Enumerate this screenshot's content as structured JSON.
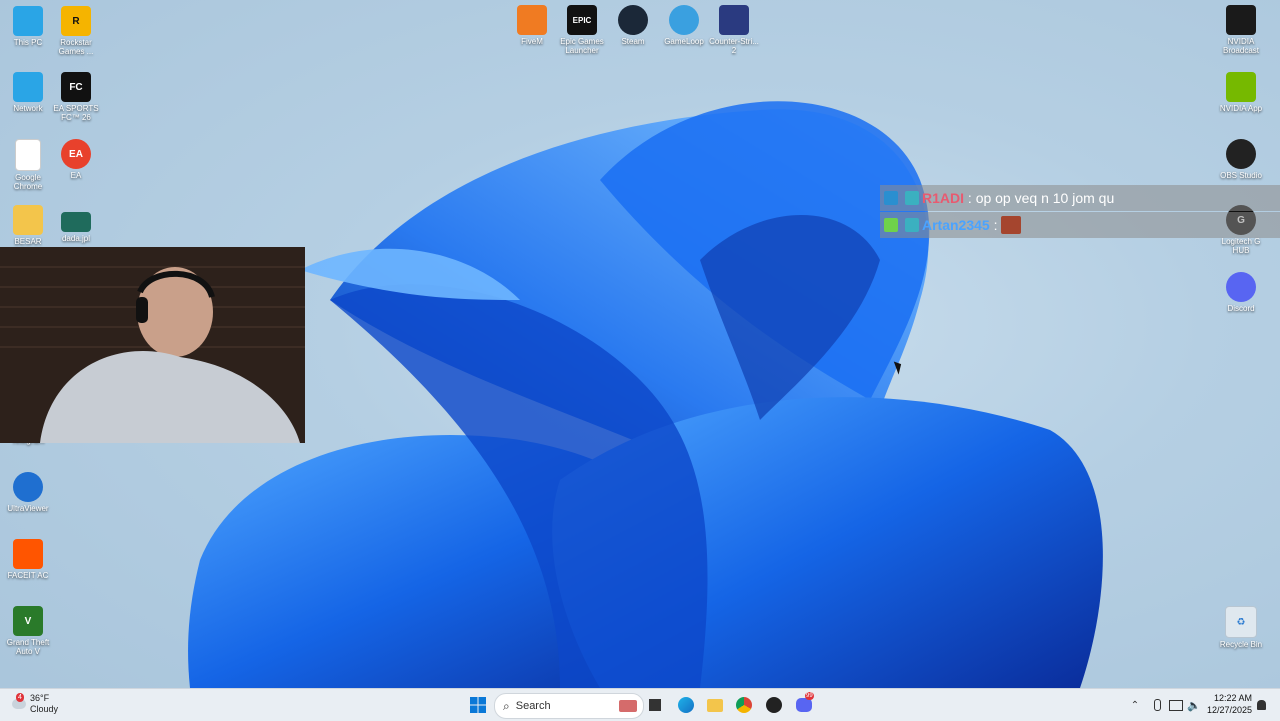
{
  "desktop_icons_left": [
    {
      "label": "This PC",
      "icon": "monitor-icon",
      "color": "#2aa5e6"
    },
    {
      "label": "Rockstar Games ...",
      "icon": "rockstar-icon",
      "color": "#f5b400"
    },
    {
      "label": "Network",
      "icon": "network-icon",
      "color": "#2aa5e6"
    },
    {
      "label": "EA SPORTS FC™ 26",
      "icon": "fc26-icon",
      "color": "#111111"
    },
    {
      "label": "Google Chrome",
      "icon": "file-icon",
      "color": "#ffffff"
    },
    {
      "label": "EA",
      "icon": "ea-icon",
      "color": "#e8412c"
    },
    {
      "label": "BESAR",
      "icon": "folder-icon",
      "color": "#f3c54b"
    },
    {
      "label": "dada.jpl",
      "icon": "image-icon",
      "color": "#1f6b5c"
    },
    {
      "label": "Telegram",
      "icon": "telegram-icon",
      "color": "#2aa5e6"
    },
    {
      "label": "UltraViewer",
      "icon": "ultraviewer-icon",
      "color": "#1f6fd0"
    },
    {
      "label": "FACEIT AC",
      "icon": "faceit-icon",
      "color": "#ff5500"
    },
    {
      "label": "Grand Theft Auto V",
      "icon": "gta-icon",
      "color": "#2a7a2a"
    }
  ],
  "desktop_icons_top": [
    {
      "label": "FiveM",
      "icon": "fivem-icon",
      "color": "#f07b22"
    },
    {
      "label": "Epic Games Launcher",
      "icon": "epic-icon",
      "color": "#111111"
    },
    {
      "label": "Steam",
      "icon": "steam-icon",
      "color": "#1b2838"
    },
    {
      "label": "GameLoop",
      "icon": "gameloop-icon",
      "color": "#3aa0e0"
    },
    {
      "label": "Counter-Stri... 2",
      "icon": "cs2-icon",
      "color": "#e6a020"
    }
  ],
  "desktop_icons_right": [
    {
      "label": "NVIDIA Broadcast",
      "icon": "nvidia-broadcast-icon",
      "color": "#1a1a1a"
    },
    {
      "label": "NVIDIA App",
      "icon": "nvidia-icon",
      "color": "#76b900"
    },
    {
      "label": "OBS Studio",
      "icon": "obs-icon",
      "color": "#222222"
    },
    {
      "label": "Logitech G HUB",
      "icon": "logitech-icon",
      "color": "#111111"
    },
    {
      "label": "Discord",
      "icon": "discord-icon",
      "color": "#5865f2"
    },
    {
      "label": "Recycle Bin",
      "icon": "recycle-bin-icon",
      "color": "#dfe8ef"
    }
  ],
  "chat": [
    {
      "user": "R1ADI",
      "user_color": "#e85a70",
      "message": "op op veq n 10 jom qu"
    },
    {
      "user": "Artan2345",
      "user_color": "#4aa3ff",
      "message": ""
    }
  ],
  "taskbar": {
    "search_placeholder": "Search",
    "weather_temp": "36°F",
    "weather_desc": "Cloudy",
    "weather_badge": "4",
    "time": "12:22 AM",
    "date": "12/27/2025",
    "discord_badge": "99"
  }
}
